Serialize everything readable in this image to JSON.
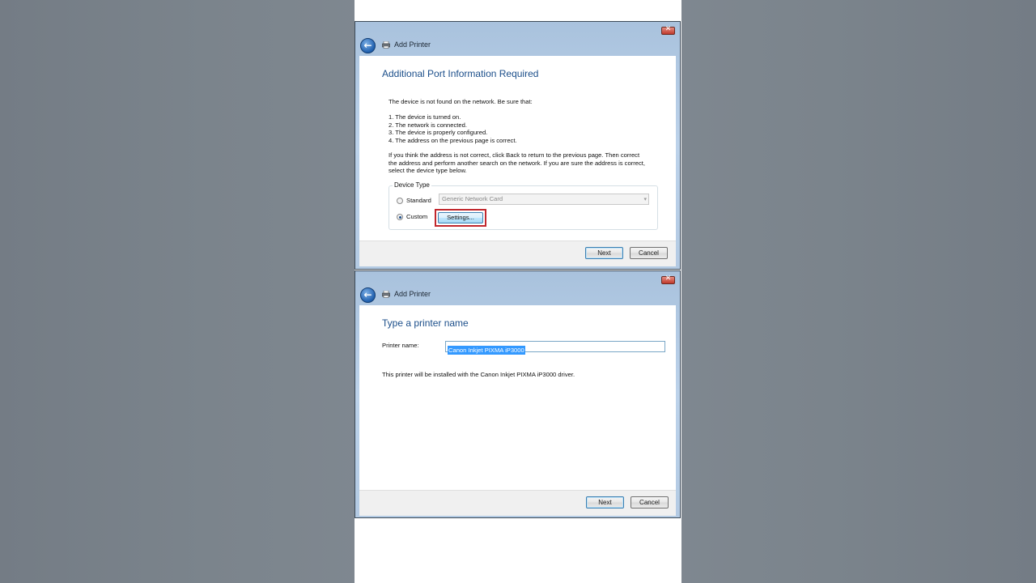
{
  "dialog1": {
    "title": "Add Printer",
    "heading": "Additional Port Information Required",
    "intro": "The device is not found on the network.  Be sure that:",
    "checklist": [
      "1.   The device is turned on.",
      "2.   The network is connected.",
      "3.   The device is properly configured.",
      "4.   The address on the previous page is correct."
    ],
    "paragraph": [
      "If you think the address is not correct, click Back to return to the previous page.  Then correct",
      "the address and perform another search on the network.  If you are sure the address is correct,",
      "select the device type below."
    ],
    "group_label": "Device Type",
    "standard_label": "Standard",
    "standard_value": "Generic Network Card",
    "custom_label": "Custom",
    "settings_label": "Settings...",
    "next_label": "Next",
    "cancel_label": "Cancel"
  },
  "dialog2": {
    "title": "Add Printer",
    "heading": "Type a printer name",
    "name_label": "Printer name:",
    "name_value": "Canon Inkjet PIXMA iP3000",
    "info": "This printer will be installed with the Canon Inkjet PIXMA iP3000 driver.",
    "next_label": "Next",
    "cancel_label": "Cancel"
  },
  "colors": {
    "accent": "#1b4e8a",
    "highlight": "#c1272d",
    "selection": "#3399ff"
  }
}
